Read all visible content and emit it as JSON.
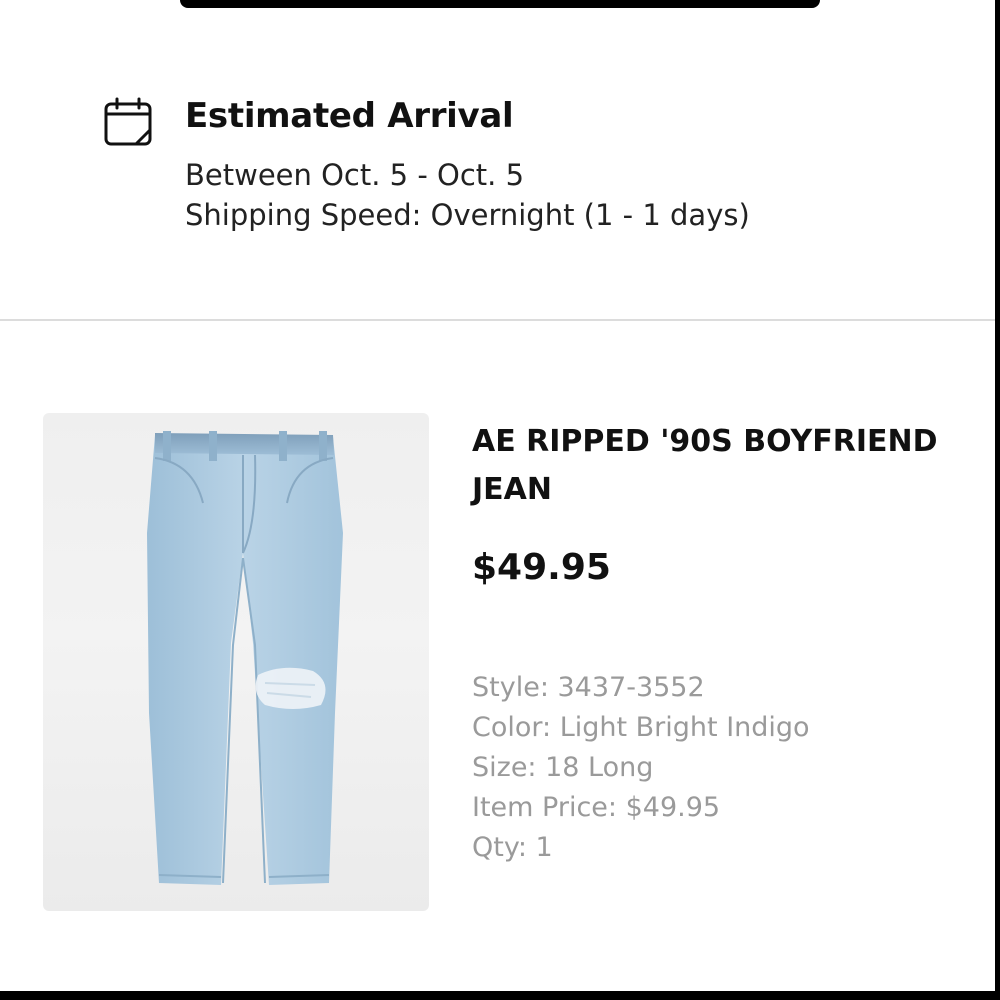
{
  "arrival": {
    "icon": "calendar-icon",
    "title": "Estimated Arrival",
    "range": "Between Oct. 5 - Oct. 5",
    "speed": "Shipping Speed: Overnight (1 - 1 days)"
  },
  "product": {
    "image_icon": "jeans-image",
    "name": "AE RIPPED '90S BOYFRIEND JEAN",
    "price": "$49.95",
    "details": {
      "style": "Style: 3437-3552",
      "color": "Color: Light Bright Indigo",
      "size": "Size: 18 Long",
      "item_price": "Item Price: $49.95",
      "qty": "Qty: 1"
    }
  },
  "colors": {
    "background": "#ffffff",
    "text_primary": "#111111",
    "text_secondary": "#9a9a9a",
    "divider": "#dcdcdc",
    "denim": "#a9c8de"
  }
}
